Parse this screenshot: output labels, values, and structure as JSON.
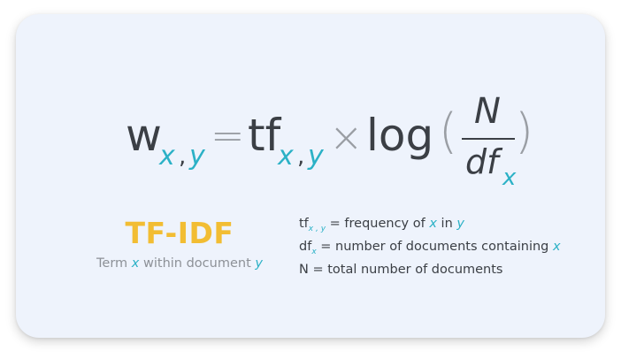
{
  "formula": {
    "w": "w",
    "sub_x": "x",
    "sub_comma": ",",
    "sub_y": "y",
    "equals": "=",
    "tf": "tf",
    "tf_sub_x": "x",
    "tf_sub_comma": ",",
    "tf_sub_y": "y",
    "times": "×",
    "log": "log",
    "open_paren": "(",
    "numerator": "N",
    "denominator": "df",
    "denominator_sub": "x",
    "close_paren": ")"
  },
  "title": {
    "label": "TF-IDF",
    "subtitle_prefix": "Term",
    "subtitle_var1": "x",
    "subtitle_middle": "within document",
    "subtitle_var2": "y"
  },
  "legend": {
    "items": [
      {
        "term": "tf",
        "sub": "x , y",
        "text_before": "= frequency of",
        "var1": "x",
        "text_middle": "in",
        "var2": "y"
      },
      {
        "term": "df",
        "sub": "x",
        "text_before": "= number of documents containing",
        "var1": "x"
      },
      {
        "term": "N",
        "text_before": "= total number of documents"
      }
    ]
  },
  "colors": {
    "accent_teal": "#2bb1c6",
    "title_yellow": "#f2bd33",
    "text_dark": "#3b3f45",
    "operator_gray": "#9a9ea4",
    "card_background": "#eef3fc"
  }
}
